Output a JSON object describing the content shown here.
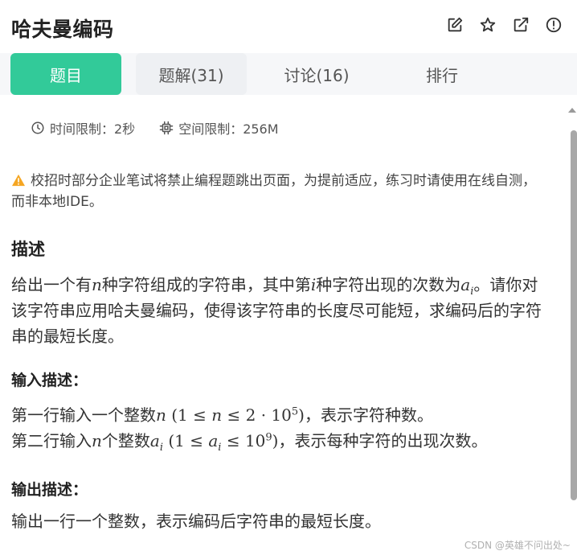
{
  "header": {
    "title": "哈夫曼编码",
    "icons": [
      "edit-icon",
      "star-icon",
      "external-link-icon",
      "info-icon"
    ]
  },
  "tabs": [
    {
      "label": "题目",
      "active": true
    },
    {
      "label": "题解(31)",
      "active": false
    },
    {
      "label": "讨论(16)",
      "active": false
    },
    {
      "label": "排行",
      "active": false
    }
  ],
  "limits": {
    "time": "时间限制：2秒",
    "memory": "空间限制：256M"
  },
  "notice": "校招时部分企业笔试将禁止编程题跳出页面，为提前适应，练习时请使用在线自测，而非本地IDE。",
  "description": {
    "heading": "描述",
    "text_1": "给出一个有",
    "var_n": "n",
    "text_2": "种字符组成的字符串，其中第",
    "var_i": "i",
    "text_3": "种字符出现的次数为",
    "var_a": "a",
    "sub_i": "i",
    "text_4": "。请你对该字符串应用哈夫曼编码，使得该字符串的长度尽可能短，求编码后的字符串的最短长度。"
  },
  "input": {
    "heading": "输入描述：",
    "line1_a": "第一行输入一个整数",
    "line1_var": "n",
    "line1_open": " (1 ≤ ",
    "line1_n": "n",
    "line1_mid": " ≤ 2 · 10",
    "line1_exp": "5",
    "line1_close": ")",
    "line1_b": "，表示字符种数。",
    "line2_a": "第二行输入",
    "line2_var": "n",
    "line2_b": "个整数",
    "line2_a_var": "a",
    "line2_sub": "i",
    "line2_open": " (1 ≤ ",
    "line2_ai": "a",
    "line2_ai_sub": "i",
    "line2_mid": " ≤ 10",
    "line2_exp": "9",
    "line2_close": ")",
    "line2_c": "，表示每种字符的出现次数。"
  },
  "output": {
    "heading": "输出描述：",
    "text": "输出一行一个整数，表示编码后字符串的最短长度。"
  },
  "watermark": "CSDN @英雄不问出处~",
  "colors": {
    "accent": "#32ca99",
    "warning": "#f5a623"
  }
}
